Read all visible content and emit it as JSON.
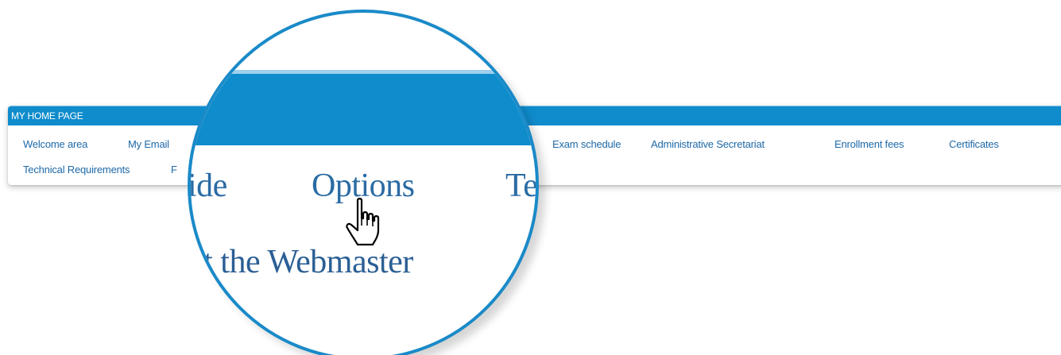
{
  "nav": {
    "header": "MY HOME PAGE",
    "links": [
      "Welcome area",
      "My Email",
      "Exam schedule",
      "Administrative Secretariat",
      "Enrollment fees",
      "Certificates",
      "Technical Requirements",
      "F"
    ]
  },
  "magnifier": {
    "words": [
      "ide",
      "Options",
      "Te",
      "ct the Webmaster"
    ]
  },
  "colors": {
    "bar": "#0f8ccc",
    "link": "#1e69a8",
    "ring": "#1a8ac8"
  },
  "cursor_icon": "hand-pointer-icon"
}
